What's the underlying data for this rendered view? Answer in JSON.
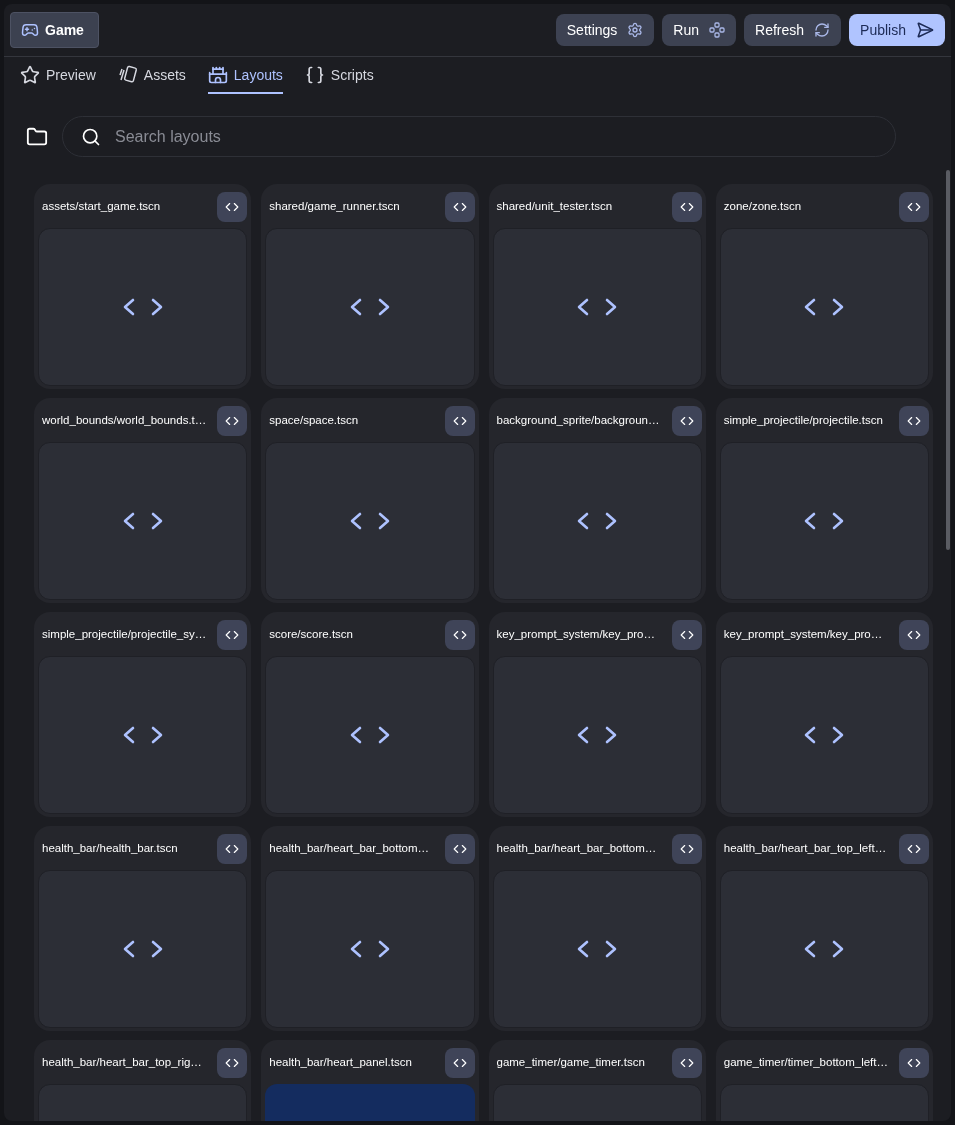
{
  "project_button": {
    "label": "Game"
  },
  "actions": [
    {
      "label": "Settings",
      "kind": "settings"
    },
    {
      "label": "Run",
      "kind": "run"
    },
    {
      "label": "Refresh",
      "kind": "refresh"
    },
    {
      "label": "Publish",
      "kind": "publish"
    }
  ],
  "tabs": [
    {
      "label": "Preview",
      "kind": "preview",
      "selected": false
    },
    {
      "label": "Assets",
      "kind": "assets",
      "selected": false
    },
    {
      "label": "Layouts",
      "kind": "layouts",
      "selected": true
    },
    {
      "label": "Scripts",
      "kind": "scripts",
      "selected": false
    }
  ],
  "search": {
    "placeholder": "Search layouts"
  },
  "layouts": [
    {
      "name": "assets/start_game.tscn",
      "kind": "code"
    },
    {
      "name": "shared/game_runner.tscn",
      "kind": "code"
    },
    {
      "name": "shared/unit_tester.tscn",
      "kind": "code"
    },
    {
      "name": "zone/zone.tscn",
      "kind": "code"
    },
    {
      "name": "world_bounds/world_bounds.t…",
      "kind": "code"
    },
    {
      "name": "space/space.tscn",
      "kind": "code"
    },
    {
      "name": "background_sprite/backgroun…",
      "kind": "code"
    },
    {
      "name": "simple_projectile/projectile.tscn",
      "kind": "code"
    },
    {
      "name": "simple_projectile/projectile_sy…",
      "kind": "code"
    },
    {
      "name": "score/score.tscn",
      "kind": "code"
    },
    {
      "name": "key_prompt_system/key_pro…",
      "kind": "code"
    },
    {
      "name": "key_prompt_system/key_pro…",
      "kind": "code"
    },
    {
      "name": "health_bar/health_bar.tscn",
      "kind": "code"
    },
    {
      "name": "health_bar/heart_bar_bottom…",
      "kind": "code"
    },
    {
      "name": "health_bar/heart_bar_bottom…",
      "kind": "code"
    },
    {
      "name": "health_bar/heart_bar_top_left…",
      "kind": "code"
    },
    {
      "name": "health_bar/heart_bar_top_rig…",
      "kind": "code"
    },
    {
      "name": "health_bar/heart_panel.tscn",
      "kind": "image"
    },
    {
      "name": "game_timer/game_timer.tscn",
      "kind": "code"
    },
    {
      "name": "game_timer/timer_bottom_left…",
      "kind": "code"
    }
  ]
}
